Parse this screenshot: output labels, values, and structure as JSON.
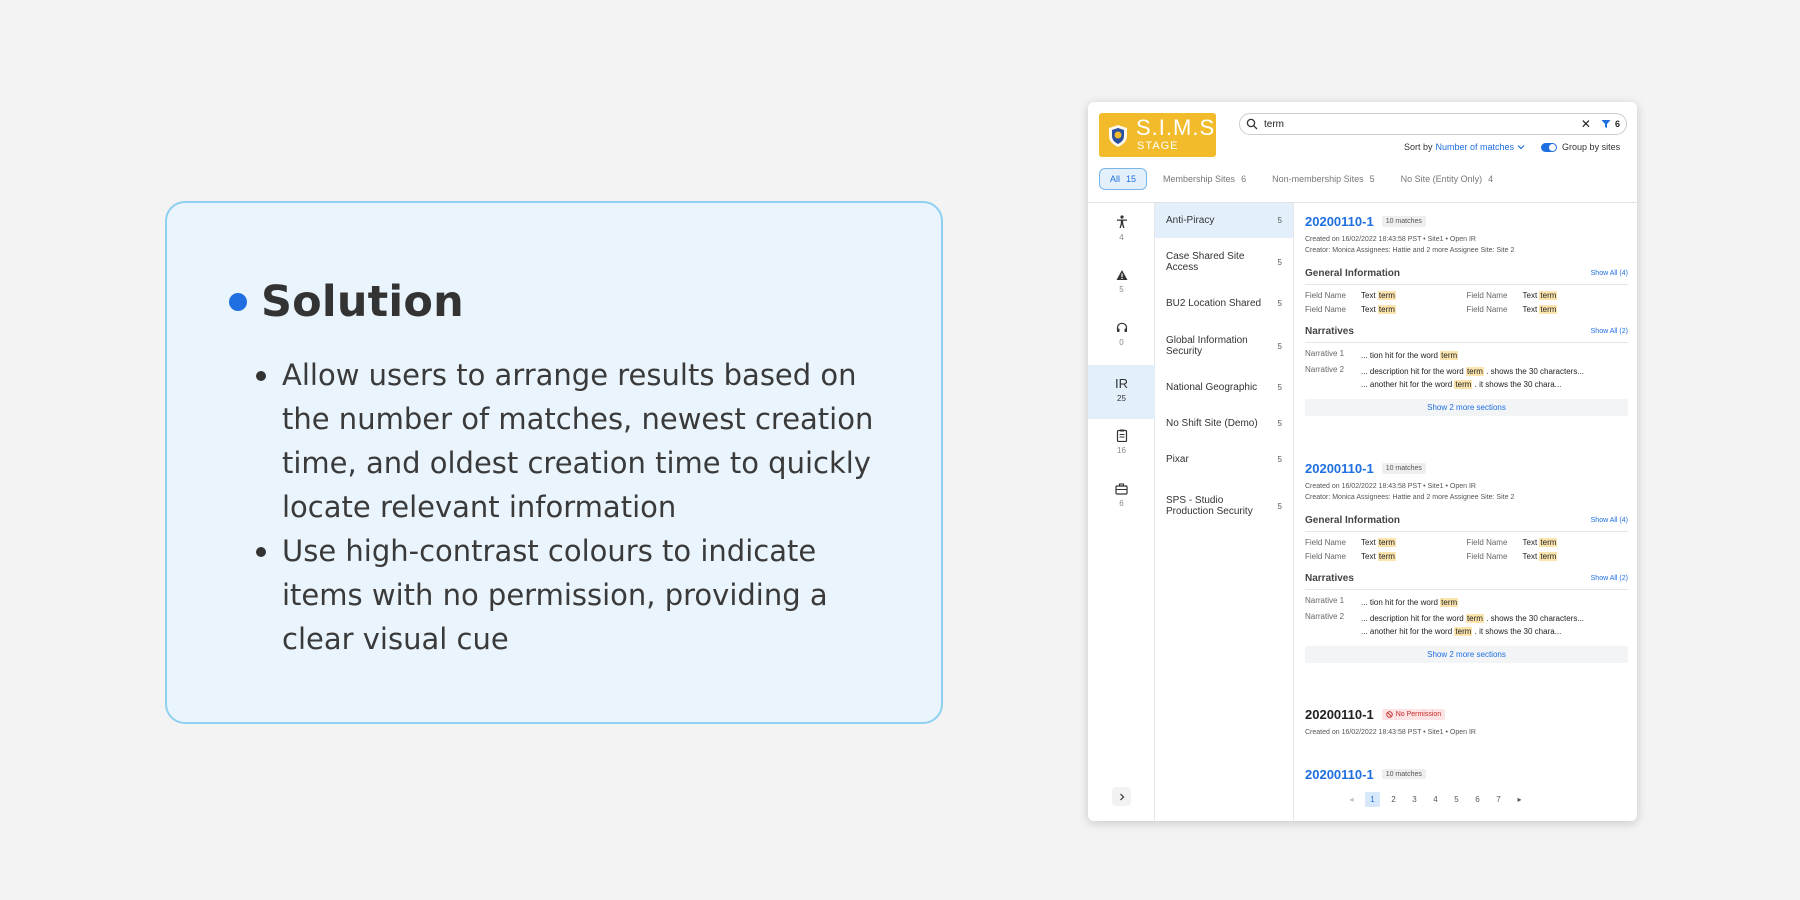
{
  "solution": {
    "title": "Solution",
    "bullets": [
      "Allow users to arrange results based on the number of matches, newest creation time, and oldest creation time to quickly locate relevant information",
      "Use high-contrast colours to indicate items with no permission, providing a clear visual cue"
    ]
  },
  "app": {
    "logo": {
      "title": "S.I.M.S.",
      "subtitle": "STAGE"
    },
    "search": {
      "value": "term",
      "clear": "✕",
      "filter_count": "6"
    },
    "sort": {
      "label": "Sort by",
      "value": "Number of matches",
      "group_label": "Group by sites"
    },
    "tabs": [
      {
        "label": "All",
        "count": "15"
      },
      {
        "label": "Membership Sites",
        "count": "6"
      },
      {
        "label": "Non-membership Sites",
        "count": "5"
      },
      {
        "label": "No Site (Entity Only)",
        "count": "4"
      }
    ],
    "rail": [
      {
        "icon": "person-icon",
        "count": "4"
      },
      {
        "icon": "warning-icon",
        "count": "5"
      },
      {
        "icon": "headset-icon",
        "count": "0"
      },
      {
        "label": "IR",
        "count": "25"
      },
      {
        "icon": "clipboard-icon",
        "count": "16"
      },
      {
        "icon": "briefcase-icon",
        "count": "6"
      }
    ],
    "sites": [
      {
        "name": "Anti-Piracy",
        "count": "5"
      },
      {
        "name": "Case Shared Site Access",
        "count": "5"
      },
      {
        "name": "BU2 Location Shared",
        "count": "5"
      },
      {
        "name": "Global Information Security",
        "count": "5"
      },
      {
        "name": "National Geographic",
        "count": "5"
      },
      {
        "name": "No Shift Site (Demo)",
        "count": "5"
      },
      {
        "name": "Pixar",
        "count": "5"
      },
      {
        "name": "SPS - Studio Production Security",
        "count": "5"
      }
    ],
    "results": [
      {
        "id": "20200110-1",
        "badge": "10 matches",
        "meta1": "Created on 16/02/2022 18:43:58 PST  •  Site1  •  Open IR",
        "meta2": "Creator:  Monica      Assignees: Hattie and 2 more      Assignee Site: Site 2",
        "general_title": "General Information",
        "show_all_general": "Show All (4)",
        "field_name": "Field Name",
        "field_text": "Text",
        "term": "term",
        "narratives_title": "Narratives",
        "show_all_narr": "Show All (2)",
        "narr1_name": "Narrative 1",
        "narr1_pre": "... tion hit for the word",
        "narr2_name": "Narrative 2",
        "narr2_pre": "... description hit for the word",
        "narr2_post": ". shows the 30 characters...",
        "narr3_pre": "...  another hit for the word",
        "narr3_post": ". it shows the 30 chara...",
        "show_more": "Show 2 more sections"
      },
      {
        "id": "20200110-1",
        "badge": "10 matches",
        "meta1": "Created on 16/02/2022 18:43:58 PST  •  Site1  •  Open IR",
        "meta2": "Creator:  Monica      Assignees: Hattie and 2 more      Assignee Site: Site 2",
        "general_title": "General Information",
        "show_all_general": "Show All (4)",
        "field_name": "Field Name",
        "field_text": "Text",
        "term": "term",
        "narratives_title": "Narratives",
        "show_all_narr": "Show All (2)",
        "narr1_name": "Narrative 1",
        "narr1_pre": "... tion hit for the word",
        "narr2_name": "Narrative 2",
        "narr2_pre": "... description hit for the word",
        "narr2_post": ". shows the 30 characters...",
        "narr3_pre": "...  another hit for the word",
        "narr3_post": ". it shows the 30 chara...",
        "show_more": "Show 2 more sections"
      }
    ],
    "noperm": {
      "id": "20200110-1",
      "badge": "No Permission",
      "meta1": "Created on 16/02/2022 18:43:58 PST  •  Site1  •  Open IR"
    },
    "partial": {
      "id": "20200110-1",
      "badge": "10 matches"
    },
    "pager": {
      "pages": [
        "1",
        "2",
        "3",
        "4",
        "5",
        "6",
        "7"
      ],
      "prev": "◂",
      "next": "▸"
    },
    "colors": {
      "accent": "#1f6fe0",
      "logo": "#f2bb2b",
      "highlight": "#fbe4ae",
      "no_permission": "#c62828"
    }
  }
}
